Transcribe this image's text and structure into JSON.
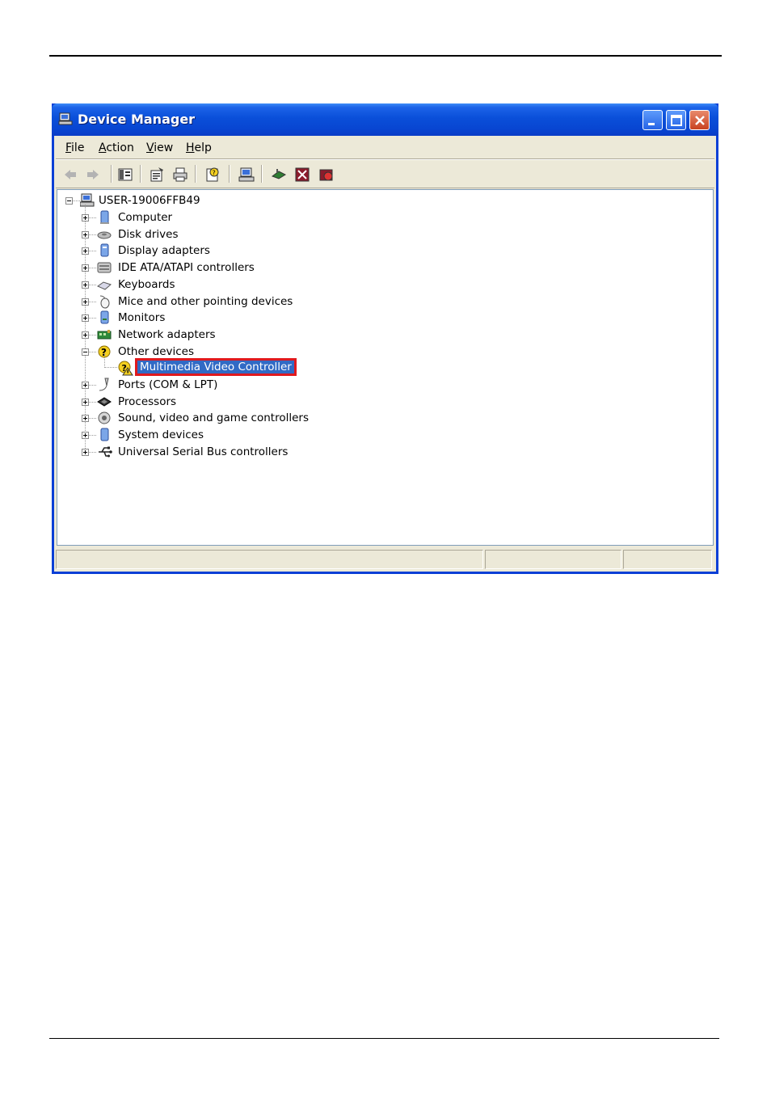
{
  "window": {
    "title": "Device Manager",
    "accent_color": "#0a4fd9",
    "close_color": "#d2502d"
  },
  "menu": [
    {
      "label": "File",
      "accel": "F"
    },
    {
      "label": "Action",
      "accel": "A"
    },
    {
      "label": "View",
      "accel": "V"
    },
    {
      "label": "Help",
      "accel": "H"
    }
  ],
  "toolbar": {
    "icons": [
      "back-arrow-icon",
      "forward-arrow-icon",
      "show-hide-console-tree-icon",
      "properties-icon",
      "print-icon",
      "help-icon",
      "scan-hardware-icon",
      "update-driver-icon",
      "uninstall-icon",
      "disable-icon"
    ]
  },
  "tree": {
    "root": "USER-19006FFB49",
    "items": [
      {
        "label": "Computer",
        "icon": "computer-icon",
        "expanded": false
      },
      {
        "label": "Disk drives",
        "icon": "disk-drive-icon",
        "expanded": false
      },
      {
        "label": "Display adapters",
        "icon": "display-adapter-icon",
        "expanded": false
      },
      {
        "label": "IDE ATA/ATAPI controllers",
        "icon": "ide-controller-icon",
        "expanded": false
      },
      {
        "label": "Keyboards",
        "icon": "keyboard-icon",
        "expanded": false
      },
      {
        "label": "Mice and other pointing devices",
        "icon": "mouse-icon",
        "expanded": false
      },
      {
        "label": "Monitors",
        "icon": "monitor-icon",
        "expanded": false
      },
      {
        "label": "Network adapters",
        "icon": "network-adapter-icon",
        "expanded": false
      },
      {
        "label": "Other devices",
        "icon": "unknown-device-icon",
        "expanded": true
      },
      {
        "label": "Ports (COM & LPT)",
        "icon": "port-icon",
        "expanded": false
      },
      {
        "label": "Processors",
        "icon": "processor-icon",
        "expanded": false
      },
      {
        "label": "Sound, video and game controllers",
        "icon": "sound-icon",
        "expanded": false
      },
      {
        "label": "System devices",
        "icon": "system-device-icon",
        "expanded": false
      },
      {
        "label": "Universal Serial Bus controllers",
        "icon": "usb-icon",
        "expanded": false
      }
    ],
    "other_devices_child": {
      "label": "Multimedia Video Controller",
      "icon": "warning-device-icon",
      "selected": true,
      "highlight_color": "#e0191e"
    }
  }
}
